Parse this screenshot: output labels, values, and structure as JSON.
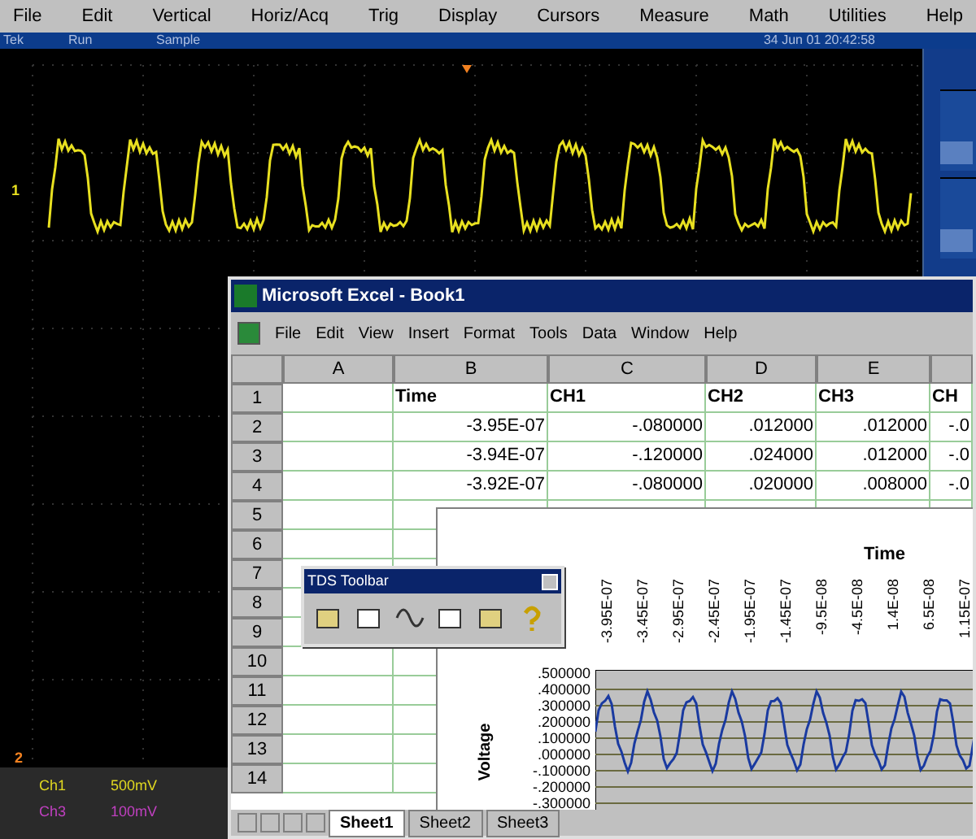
{
  "scope": {
    "menu": [
      "File",
      "Edit",
      "Vertical",
      "Horiz/Acq",
      "Trig",
      "Display",
      "Cursors",
      "Measure",
      "Math",
      "Utilities",
      "Help"
    ],
    "status": {
      "brand": "Tek",
      "state": "Run",
      "mode": "Sample",
      "datetime": "34 Jun 01 20:42:58"
    },
    "markers": [
      {
        "label": "1",
        "color": "#e8e020"
      },
      {
        "label": "2",
        "color": "#f08020"
      }
    ],
    "channels": [
      {
        "name": "Ch1",
        "scale": "500mV",
        "color": "#e0d820"
      },
      {
        "name": "Ch3",
        "scale": "100mV",
        "color": "#c040c0"
      }
    ]
  },
  "excel": {
    "title": "Microsoft Excel - Book1",
    "menu": [
      "File",
      "Edit",
      "View",
      "Insert",
      "Format",
      "Tools",
      "Data",
      "Window",
      "Help"
    ],
    "columns": [
      "A",
      "B",
      "C",
      "D",
      "E",
      ""
    ],
    "rows": [
      {
        "number": "1",
        "cells": [
          "",
          "Time",
          "CH1",
          "CH2",
          "CH3",
          "CH"
        ]
      },
      {
        "number": "2",
        "cells": [
          "",
          "-3.95E-07",
          "-.080000",
          ".012000",
          ".012000",
          "-.0"
        ]
      },
      {
        "number": "3",
        "cells": [
          "",
          "-3.94E-07",
          "-.120000",
          ".024000",
          ".012000",
          "-.0"
        ]
      },
      {
        "number": "4",
        "cells": [
          "",
          "-3.92E-07",
          "-.080000",
          ".020000",
          ".008000",
          "-.0"
        ]
      },
      {
        "number": "5",
        "cells": []
      },
      {
        "number": "6",
        "cells": []
      },
      {
        "number": "7",
        "cells": []
      },
      {
        "number": "8",
        "cells": []
      },
      {
        "number": "9",
        "cells": []
      },
      {
        "number": "10",
        "cells": []
      },
      {
        "number": "11",
        "cells": []
      },
      {
        "number": "12",
        "cells": []
      },
      {
        "number": "13",
        "cells": []
      },
      {
        "number": "14",
        "cells": []
      }
    ],
    "sheets": [
      {
        "label": "Sheet1",
        "selected": true
      },
      {
        "label": "Sheet2",
        "selected": false
      },
      {
        "label": "Sheet3",
        "selected": false
      }
    ],
    "chart": {
      "xlabel": "Time",
      "ylabel": "Voltage",
      "xtick_labels": [
        "-3.95E-07",
        "-3.45E-07",
        "-2.95E-07",
        "-2.45E-07",
        "-1.95E-07",
        "-1.45E-07",
        "-9.5E-08",
        "-4.5E-08",
        "1.4E-08",
        "6.5E-08",
        "1.15E-07"
      ],
      "ytick_labels": [
        ".500000",
        ".400000",
        ".300000",
        ".200000",
        ".100000",
        ".000000",
        "-.100000",
        "-.200000",
        "-.300000"
      ]
    },
    "toolbar": {
      "title": "TDS Toolbar"
    }
  }
}
